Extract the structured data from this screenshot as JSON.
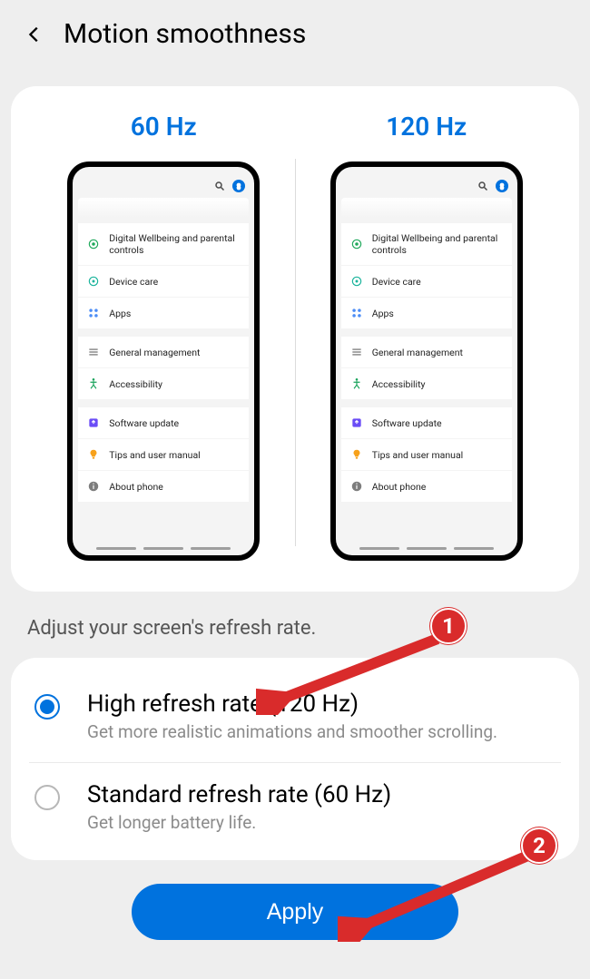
{
  "header": {
    "title": "Motion smoothness"
  },
  "preview": {
    "left_label": "60 Hz",
    "right_label": "120 Hz",
    "phone_items": [
      {
        "icon": "wellbeing",
        "label": "Digital Wellbeing and parental controls"
      },
      {
        "icon": "care",
        "label": "Device care"
      },
      {
        "icon": "apps",
        "label": "Apps"
      },
      {
        "icon": "general",
        "label": "General management"
      },
      {
        "icon": "access",
        "label": "Accessibility"
      },
      {
        "icon": "update",
        "label": "Software update"
      },
      {
        "icon": "tips",
        "label": "Tips and user manual"
      },
      {
        "icon": "about",
        "label": "About phone"
      }
    ]
  },
  "instruction": "Adjust your screen's refresh rate.",
  "options": [
    {
      "title": "High refresh rate (120 Hz)",
      "subtitle": "Get more realistic animations and smoother scrolling.",
      "selected": true
    },
    {
      "title": "Standard refresh rate (60 Hz)",
      "subtitle": "Get longer battery life.",
      "selected": false
    }
  ],
  "apply_label": "Apply",
  "annotations": {
    "one": "1",
    "two": "2"
  }
}
